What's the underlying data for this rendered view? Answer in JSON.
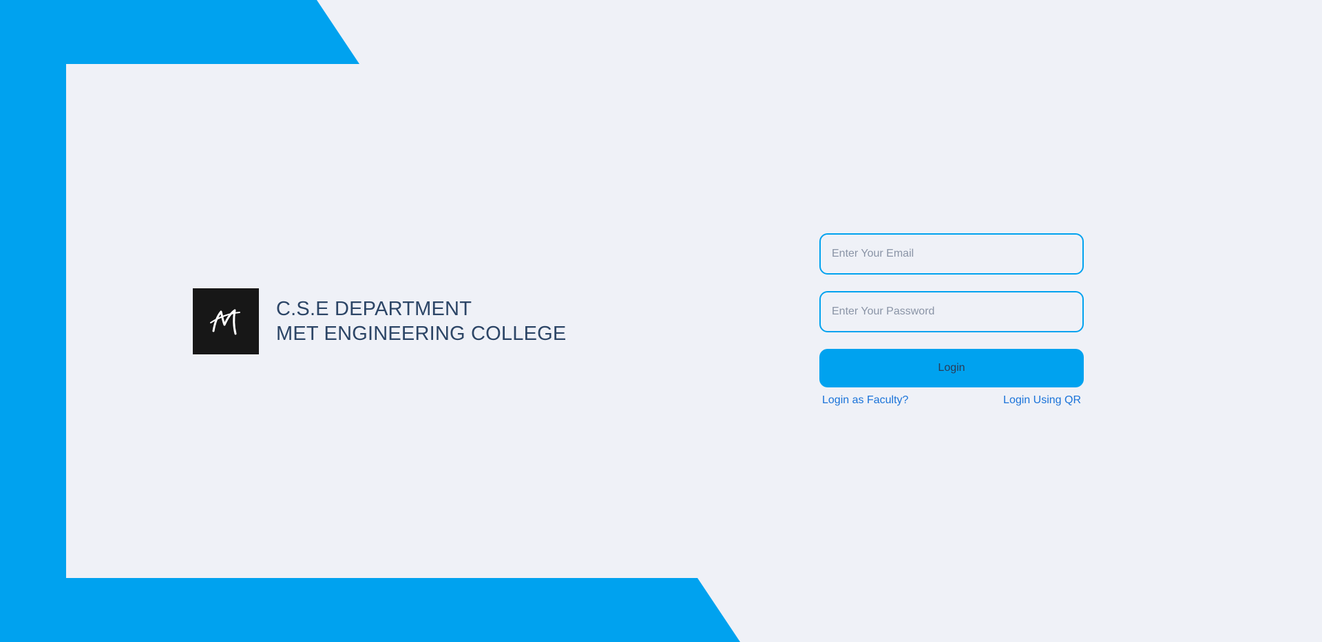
{
  "theme": {
    "accent": "#00a2ef",
    "background": "#eff1f7",
    "title_color": "#2c4566",
    "link_color": "#1a73d9"
  },
  "brand": {
    "logo_icon": "college-monogram-icon",
    "line1": "C.S.E DEPARTMENT",
    "line2": "MET ENGINEERING COLLEGE"
  },
  "form": {
    "email_placeholder": "Enter Your Email",
    "email_value": "",
    "password_placeholder": "Enter Your Password",
    "password_value": "",
    "login_label": "Login",
    "faculty_link": "Login as Faculty?",
    "qr_link": "Login Using QR"
  }
}
